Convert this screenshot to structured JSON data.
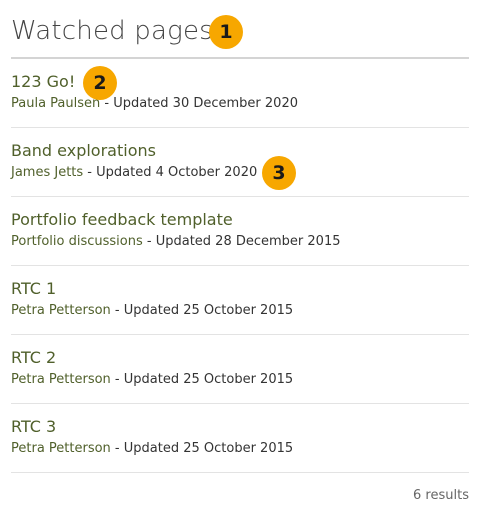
{
  "header": {
    "title": "Watched pages"
  },
  "badges": [
    "1",
    "2",
    "3"
  ],
  "pages": [
    {
      "title": "123 Go!",
      "owner": "Paula Paulsen",
      "updated": " - Updated 30 December 2020"
    },
    {
      "title": "Band explorations",
      "owner": "James Jetts",
      "updated": " - Updated 4 October 2020"
    },
    {
      "title": "Portfolio feedback template",
      "owner": "Portfolio discussions",
      "updated": " - Updated 28 December 2015"
    },
    {
      "title": "RTC 1",
      "owner": "Petra Petterson",
      "updated": " - Updated 25 October 2015"
    },
    {
      "title": "RTC 2",
      "owner": "Petra Petterson",
      "updated": " - Updated 25 October 2015"
    },
    {
      "title": "RTC 3",
      "owner": "Petra Petterson",
      "updated": " - Updated 25 October 2015"
    }
  ],
  "footer": {
    "results": "6 results"
  },
  "colors": {
    "link": "#50602b",
    "badge": "#f7a700",
    "divider": "#e3e3e3"
  }
}
